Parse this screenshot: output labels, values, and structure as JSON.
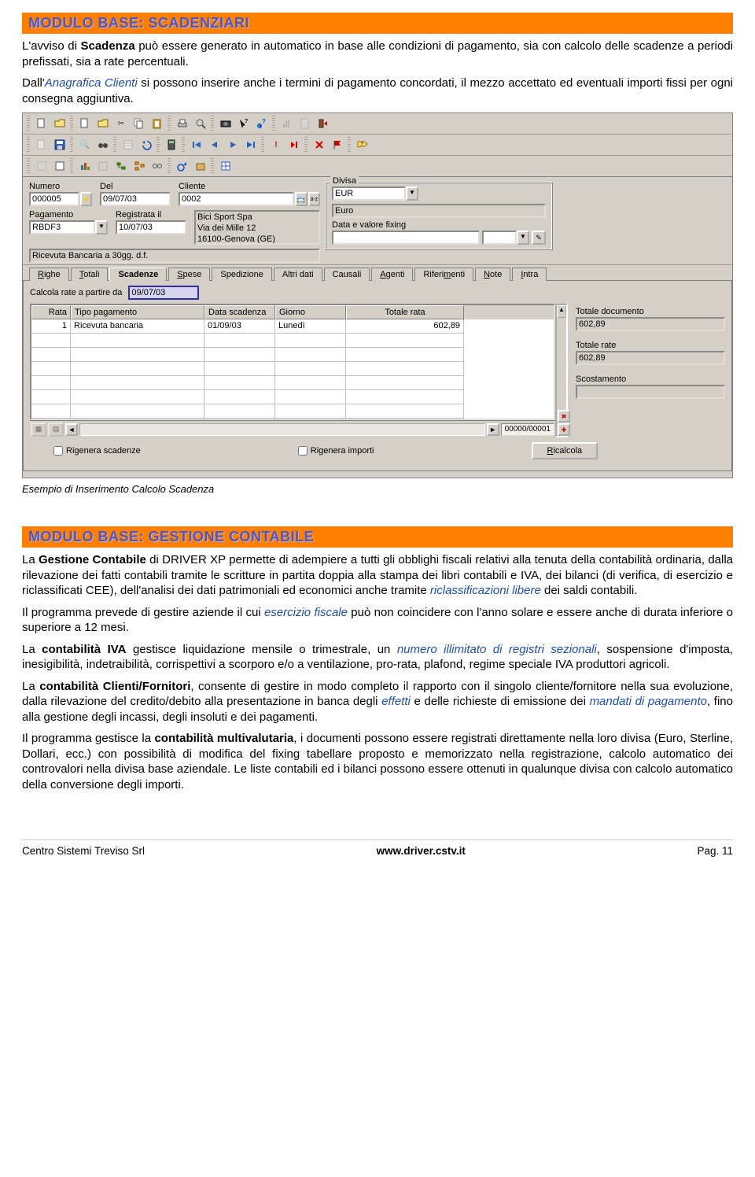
{
  "section1": {
    "title": "MODULO BASE: SCADENZIARI",
    "p1a": "L'avviso di ",
    "p1b": "Scadenza",
    "p1c": " può essere generato in automatico in base alle condizioni di pagamento, sia con calcolo delle scadenze a periodi prefissati, sia a rate percentuali.",
    "p2a": "Dall'",
    "p2b": "Anagrafica Clienti",
    "p2c": " si possono inserire anche i termini di pagamento concordati, il mezzo accettato ed eventuali importi fissi per ogni consegna aggiuntiva."
  },
  "win": {
    "fields": {
      "numero_lbl": "Numero",
      "numero": "000005",
      "del_lbl": "Del",
      "del": "09/07/03",
      "cliente_lbl": "Cliente",
      "cliente": "0002",
      "cliente_desc": "Bici Sport Spa\nVia dei Mille 12\n16100-Genova (GE)",
      "pagamento_lbl": "Pagamento",
      "pagamento": "RBDF3",
      "registrata_lbl": "Registrata il",
      "registrata": "10/07/03",
      "pag_desc": "Ricevuta Bancaria a 30gg. d.f.",
      "divisa_grp": "Divisa",
      "divisa": "EUR",
      "divisa_desc": "Euro",
      "fixing_lbl": "Data e valore fixing"
    },
    "tabs": [
      "Righe",
      "Totali",
      "Scadenze",
      "Spese",
      "Spedizione",
      "Altri dati",
      "Causali",
      "Agenti",
      "Riferimenti",
      "Note",
      "Intra"
    ],
    "tabs_u": [
      "R",
      "T",
      "",
      "S",
      "",
      "",
      "",
      "A",
      "m",
      "N",
      "I"
    ],
    "calc_lbl": "Calcola rate a partire da",
    "calc_val": "09/07/03",
    "grid_hdr": [
      "Rata",
      "Tipo pagamento",
      "Data scadenza",
      "Giorno",
      "Totale rata"
    ],
    "grid_row": [
      "1",
      "Ricevuta bancaria",
      "01/09/03",
      "Lunedì",
      "602,89"
    ],
    "totdoc_lbl": "Totale documento",
    "totdoc": "602,89",
    "totrate_lbl": "Totale rate",
    "totrate": "602,89",
    "scost_lbl": "Scostamento",
    "scost": "",
    "counter": "00000/00001",
    "chk1": "Rigenera scadenze",
    "chk2": "Rigenera importi",
    "btn_ricalc": "Ricalcola",
    "btn_ricalc_u": "R"
  },
  "caption1": "Esempio di Inserimento Calcolo Scadenza",
  "section2": {
    "title": "MODULO BASE: GESTIONE CONTABILE",
    "p1a": "La ",
    "p1b": "Gestione Contabile",
    "p1c": " di DRIVER XP permette di adempiere a tutti gli obblighi fiscali relativi alla tenuta della contabilità ordinaria, dalla rilevazione dei fatti contabili tramite le scritture in partita doppia alla stampa dei libri contabili e IVA, dei bilanci (di verifica, di esercizio e riclassificati CEE), dell'analisi dei dati patrimoniali ed economici anche tramite ",
    "p1d": "riclassificazioni libere",
    "p1e": " dei saldi contabili.",
    "p2a": "Il programma prevede di gestire aziende il cui ",
    "p2b": "esercizio fiscale",
    "p2c": " può non coincidere con l'anno solare e essere anche di durata inferiore o superiore a 12 mesi.",
    "p3a": "La ",
    "p3b": "contabilità IVA",
    "p3c": " gestisce liquidazione mensile o trimestrale, un ",
    "p3d": "numero illimitato di registri sezionali",
    "p3e": ", sospensione d'imposta, inesigibilità, indetraibilità, corrispettivi a scorporo e/o a ventilazione, pro-rata, plafond, regime speciale IVA produttori agricoli.",
    "p4a": "La ",
    "p4b": "contabilità Clienti/Fornitori",
    "p4c": ", consente di gestire in modo completo il rapporto con il singolo cliente/fornitore nella sua evoluzione, dalla rilevazione del credito/debito alla presentazione in banca degli ",
    "p4d": "effetti",
    "p4e": " e delle richieste di emissione dei ",
    "p4f": "mandati di pagamento",
    "p4g": ", fino alla gestione degli incassi, degli insoluti e dei pagamenti.",
    "p5a": "Il programma gestisce la ",
    "p5b": "contabilità multivalutaria",
    "p5c": ", i documenti possono essere registrati direttamente nella loro divisa (Euro, Sterline, Dollari, ecc.) con possibilità di modifica del fixing tabellare proposto e memorizzato nella registrazione, calcolo automatico dei controvalori nella divisa base aziendale. Le liste contabili ed i bilanci possono essere ottenuti in qualunque divisa con calcolo automatico della conversione degli importi."
  },
  "footer": {
    "left": "Centro Sistemi Treviso Srl",
    "mid": "www.driver.cstv.it",
    "right": "Pag. 11"
  }
}
